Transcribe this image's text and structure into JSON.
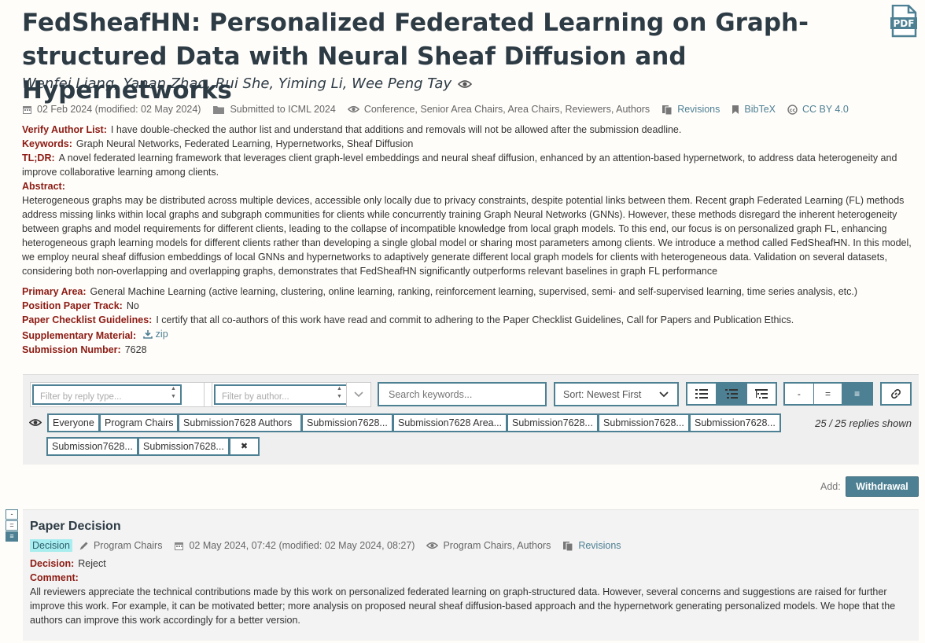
{
  "paper": {
    "title": "FedSheafHN: Personalized Federated Learning on Graph-structured Data with Neural Sheaf Diffusion and Hypernetworks",
    "authors": "Wenfei Liang, Yanan Zhao, Rui She, Yiming Li, Wee Peng Tay",
    "pdf_icon_text": "PDF"
  },
  "meta": {
    "date": "02 Feb 2024 (modified: 02 May 2024)",
    "venue": "Submitted to ICML 2024",
    "readers": "Conference, Senior Area Chairs, Area Chairs, Reviewers, Authors",
    "revisions": "Revisions",
    "bibtex": "BibTeX",
    "license": "CC BY 4.0"
  },
  "fields": {
    "verify_label": "Verify Author List:",
    "verify_value": "I have double-checked the author list and understand that additions and removals will not be allowed after the submission deadline.",
    "keywords_label": "Keywords:",
    "keywords_value": "Graph Neural Networks, Federated Learning, Hypernetworks, Sheaf Diffusion",
    "tldr_label": "TL;DR:",
    "tldr_value": "A novel federated learning framework that leverages client graph-level embeddings and neural sheaf diffusion, enhanced by an attention-based hypernetwork, to address data heterogeneity and improve collaborative learning among clients.",
    "abstract_label": "Abstract:",
    "abstract_value": "Heterogeneous graphs may be distributed across multiple devices, accessible only locally due to privacy constraints, despite potential links between them. Recent graph Federated Learning (FL) methods address missing links within local graphs and subgraph communities for clients while concurrently training Graph Neural Networks (GNNs). However, these methods disregard the inherent heterogeneity between graphs and model requirements for different clients, leading to the collapse of incompatible knowledge from local graph models. To this end, our focus is on personalized graph FL, enhancing heterogeneous graph learning models for different clients rather than developing a single global model or sharing most parameters among clients. We introduce a method called FedSheafHN. In this model, we employ neural sheaf diffusion embeddings of local GNNs and hypernetworks to adaptively generate different local graph models for clients with heterogeneous data. Validation on several datasets, considering both non-overlapping and overlapping graphs, demonstrates that FedSheafHN significantly outperforms relevant baselines in graph FL performance",
    "primary_label": "Primary Area:",
    "primary_value": "General Machine Learning (active learning, clustering, online learning, ranking, reinforcement learning, supervised, semi- and self-supervised learning, time series analysis, etc.)",
    "position_label": "Position Paper Track:",
    "position_value": "No",
    "checklist_label": "Paper Checklist Guidelines:",
    "checklist_value": "I certify that all co-authors of this work have read and commit to adhering to the Paper Checklist Guidelines, Call for Papers and Publication Ethics.",
    "supp_label": "Supplementary Material:",
    "supp_value": "zip",
    "subnum_label": "Submission Number:",
    "subnum_value": "7628"
  },
  "filters": {
    "reply_type_placeholder": "Filter by reply type...",
    "author_placeholder": "Filter by author...",
    "search_placeholder": "Search keywords...",
    "sort_label": "Sort: Newest First",
    "collapse_minus": "-",
    "collapse_eq": "=",
    "collapse_full": "≡",
    "chips": [
      "Everyone",
      "Program Chairs",
      "Submission7628 Authors",
      "Submission7628...",
      "Submission7628 Area...",
      "Submission7628...",
      "Submission7628...",
      "Submission7628...",
      "Submission7628...",
      "Submission7628..."
    ],
    "clear_chip": "✖",
    "replies_shown": "25 / 25 replies shown"
  },
  "add": {
    "label": "Add:",
    "withdrawal": "Withdrawal"
  },
  "note_collapse": [
    "-",
    "=",
    "≡"
  ],
  "decision": {
    "title": "Paper Decision",
    "badge": "Decision",
    "signature": "Program Chairs",
    "date": "02 May 2024, 07:42 (modified: 02 May 2024, 08:27)",
    "readers": "Program Chairs, Authors",
    "revisions": "Revisions",
    "decision_label": "Decision:",
    "decision_value": "Reject",
    "comment_label": "Comment:",
    "comment_value": "All reviewers appreciate the technical contributions made by this work on personalized federated learning on graph-structured data. However, several concerns and suggestions are raised for further improve this work. For example, it can be motivated better; more analysis on proposed neural sheaf diffusion-based approach and the hypernetwork generating personalized models. We hope that the authors can improve this work accordingly for a better version."
  },
  "colors": {
    "accent": "#4d8093",
    "field_label": "#8c1b13",
    "title": "#2d3b45",
    "badge_bg": "#a8edef"
  }
}
